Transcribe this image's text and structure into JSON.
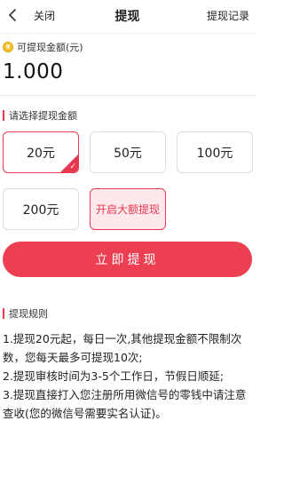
{
  "header": {
    "back_icon": "chevron-left-icon",
    "close_label": "关闭",
    "title": "提现",
    "records_label": "提现记录"
  },
  "balance": {
    "label": "可提现金额(元)",
    "coin_icon": "coin-icon",
    "coin_glyph": "¥",
    "value": "1.000"
  },
  "options": {
    "section_title": "请选择提现金额",
    "items": [
      {
        "label": "20元",
        "selected": true
      },
      {
        "label": "50元",
        "selected": false
      },
      {
        "label": "100元",
        "selected": false
      },
      {
        "label": "200元",
        "selected": false
      },
      {
        "label": "开启大额提现",
        "selected": false
      }
    ],
    "check_glyph": "✓"
  },
  "submit_label": "立即提现",
  "rules": {
    "section_title": "提现规则",
    "lines": [
      "1.提现20元起，每日一次,其他提现金额不限制次数，您每天最多可提现10次;",
      "2.提现审核时间为3-5个工作日，节假日顺延;",
      "3.提现直接打入您注册所用微信号的零钱中请注意查收(您的微信号需要实名认证)。"
    ]
  },
  "colors": {
    "accent": "#ec3f51",
    "accent_light": "#fde8eb",
    "coin": "#f6c22b"
  }
}
